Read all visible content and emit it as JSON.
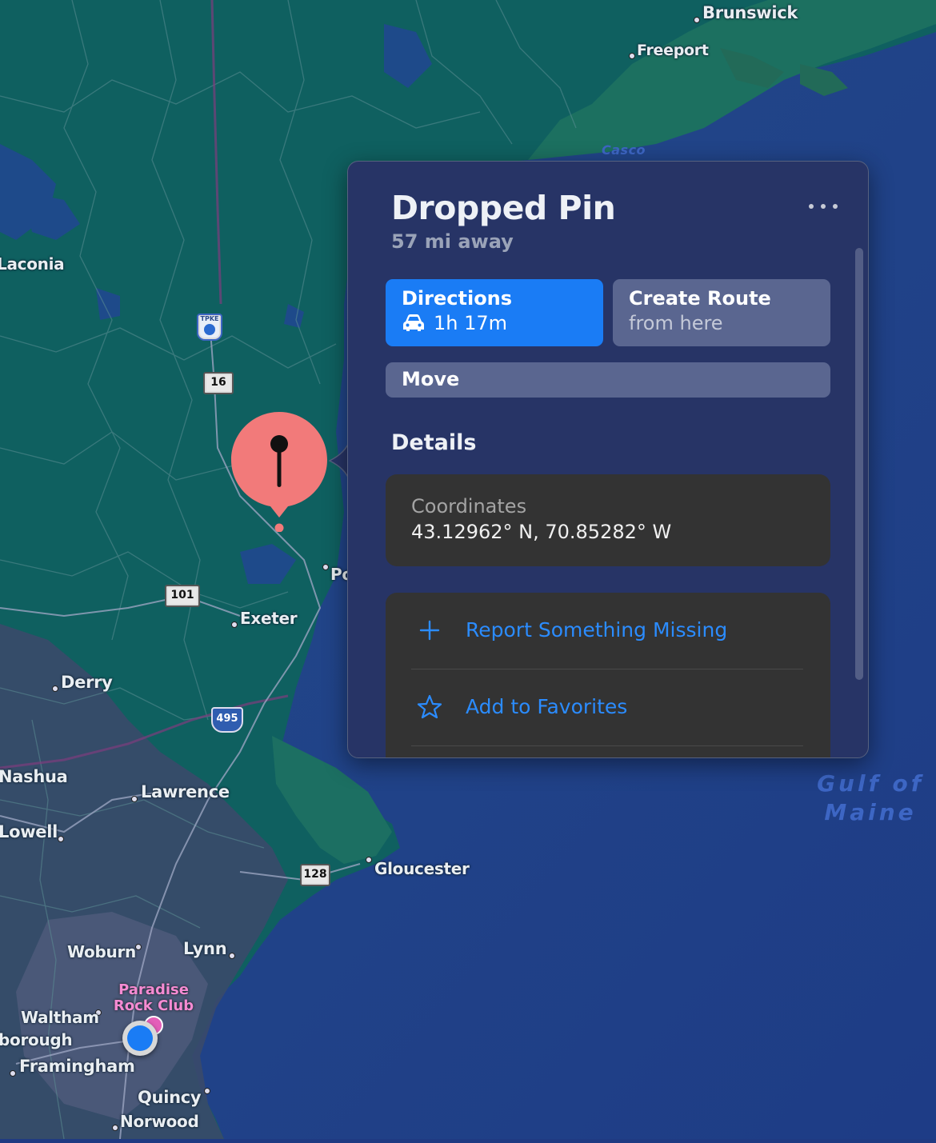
{
  "map": {
    "cities": [
      {
        "name": "Brunswick"
      },
      {
        "name": "Freeport"
      },
      {
        "name": "Laconia"
      },
      {
        "name": "Exeter"
      },
      {
        "name": "Derry"
      },
      {
        "name": "Nashua"
      },
      {
        "name": "Lawrence"
      },
      {
        "name": "Lowell"
      },
      {
        "name": "Gloucester"
      },
      {
        "name": "Woburn"
      },
      {
        "name": "Lynn"
      },
      {
        "name": "Waltham"
      },
      {
        "name": "borough"
      },
      {
        "name": "Framingham"
      },
      {
        "name": "Quincy"
      },
      {
        "name": "Norwood"
      },
      {
        "name": "Po"
      }
    ],
    "water_labels": {
      "casco": "Casco",
      "gulf_line1": "Gulf of",
      "gulf_line2": "Maine"
    },
    "highways": {
      "tpke": "TPKE",
      "nh16": "16",
      "us101": "101",
      "i495": "495",
      "ma128": "128"
    },
    "poi": {
      "line1": "Paradise",
      "line2": "Rock Club"
    },
    "colors": {
      "land": "#0f6060",
      "water": "#1f3a82",
      "urban": "#3a4a6a",
      "pin": "#f27a7a",
      "user_location": "#1a7cf5"
    }
  },
  "popover": {
    "title": "Dropped Pin",
    "distance": "57 mi away",
    "more_icon": "ellipsis-icon",
    "directions": {
      "label": "Directions",
      "time": "1h 17m",
      "icon": "car-icon"
    },
    "create_route": {
      "label": "Create Route",
      "sub": "from here"
    },
    "move": {
      "label": "Move"
    },
    "details_title": "Details",
    "coordinates": {
      "label": "Coordinates",
      "value": "43.12962° N, 70.85282° W"
    },
    "actions": [
      {
        "label": "Report Something Missing",
        "icon": "plus-icon"
      },
      {
        "label": "Add to Favorites",
        "icon": "star-icon"
      }
    ],
    "colors": {
      "accent": "#1a7cf5",
      "background": "#273466",
      "card": "#333333",
      "link": "#2b8cff"
    }
  }
}
